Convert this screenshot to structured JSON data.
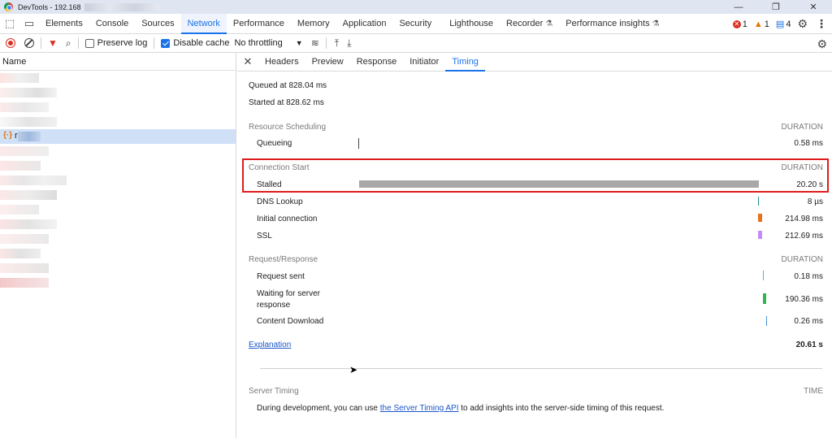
{
  "window": {
    "title": "DevTools - 192.168",
    "controls": [
      "—",
      "❐",
      "✕"
    ]
  },
  "main_tabs": [
    "Elements",
    "Console",
    "Sources",
    "Network",
    "Performance",
    "Memory",
    "Application",
    "Security",
    "Lighthouse",
    "Recorder",
    "Performance insights"
  ],
  "status": {
    "errors": "1",
    "warnings": "1",
    "info": "4"
  },
  "toolbar": {
    "preserve_log": "Preserve log",
    "disable_cache": "Disable cache",
    "throttling": "No throttling"
  },
  "request_list": {
    "header": "Name",
    "selected_name": "r      t"
  },
  "detail_tabs": [
    "Headers",
    "Preview",
    "Response",
    "Initiator",
    "Timing"
  ],
  "timing": {
    "queued": "Queued at 828.04 ms",
    "started": "Started at 828.62 ms",
    "resource_scheduling": "Resource Scheduling",
    "duration_label": "DURATION",
    "queueing_label": "Queueing",
    "queueing_value": "0.58 ms",
    "connection_start": "Connection Start",
    "stalled_label": "Stalled",
    "stalled_value": "20.20 s",
    "dns_label": "DNS Lookup",
    "dns_value": "8 µs",
    "initial_label": "Initial connection",
    "initial_value": "214.98 ms",
    "ssl_label": "SSL",
    "ssl_value": "212.69 ms",
    "request_response": "Request/Response",
    "request_sent_label": "Request sent",
    "request_sent_value": "0.18 ms",
    "waiting_label_1": "Waiting for server",
    "waiting_label_2": "response",
    "waiting_value": "190.36 ms",
    "download_label": "Content Download",
    "download_value": "0.26 ms",
    "explanation": "Explanation",
    "total": "20.61 s",
    "server_timing": "Server Timing",
    "time_label": "TIME",
    "server_note_pre": "During development, you can use ",
    "server_note_link": "the Server Timing API",
    "server_note_post": " to add insights into the server-side timing of this request."
  },
  "colors": {
    "accent": "#1a73e8",
    "highlight": "#e01b1b",
    "stalled": "#a8a8a8",
    "dns": "#1f8a8a",
    "initial": "#e8711c",
    "ssl": "#c58af9",
    "sent": "#5bb3d6",
    "waiting": "#2fb457",
    "download": "#4a90d9"
  }
}
